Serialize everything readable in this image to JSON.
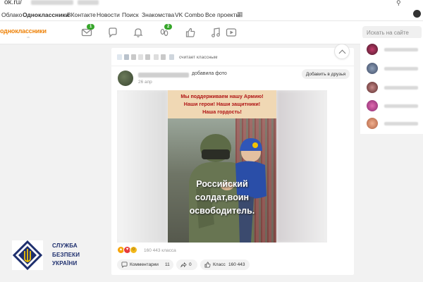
{
  "browser": {
    "url": "ok.ru/"
  },
  "bookmarks": {
    "items": [
      "Облако",
      "Одноклассники",
      "ВКонтакте",
      "Новости",
      "Поиск",
      "Знакомства",
      "VK Combo",
      "Все проекты"
    ]
  },
  "header": {
    "logo_text": "одноклассники",
    "logo_sub": "vk",
    "messages_badge": "1",
    "discussions_badge": "2",
    "search_placeholder": "Искать на сайте"
  },
  "feed": {
    "liked_text": "считает классным",
    "author_action": "добавила фото",
    "post_date": "26 апр",
    "add_friend_label": "Добавить в друзья",
    "poster_header": [
      "Мы поддерживаем нашу Армию!",
      "Наши герои! Наши защитники!",
      "Наша гордость!"
    ],
    "poster_caption": [
      "Российский",
      "солдат,воин",
      "освободитель."
    ],
    "reactions_count": "160 443 класса",
    "comments_label": "Комментарии",
    "comments_count": "11",
    "shares_count": "0",
    "klass_label": "Класс",
    "klass_count": "160 443"
  },
  "watermark": {
    "lines": [
      "СЛУЖБА",
      "БЕЗПЕКИ",
      "УКРАЇНИ"
    ]
  },
  "colors": {
    "ok_orange": "#ee8208",
    "badge_green": "#36a62a",
    "sbu_blue": "#1e2f6e",
    "sbu_gold": "#f2c200",
    "poster_red": "#b01515"
  }
}
